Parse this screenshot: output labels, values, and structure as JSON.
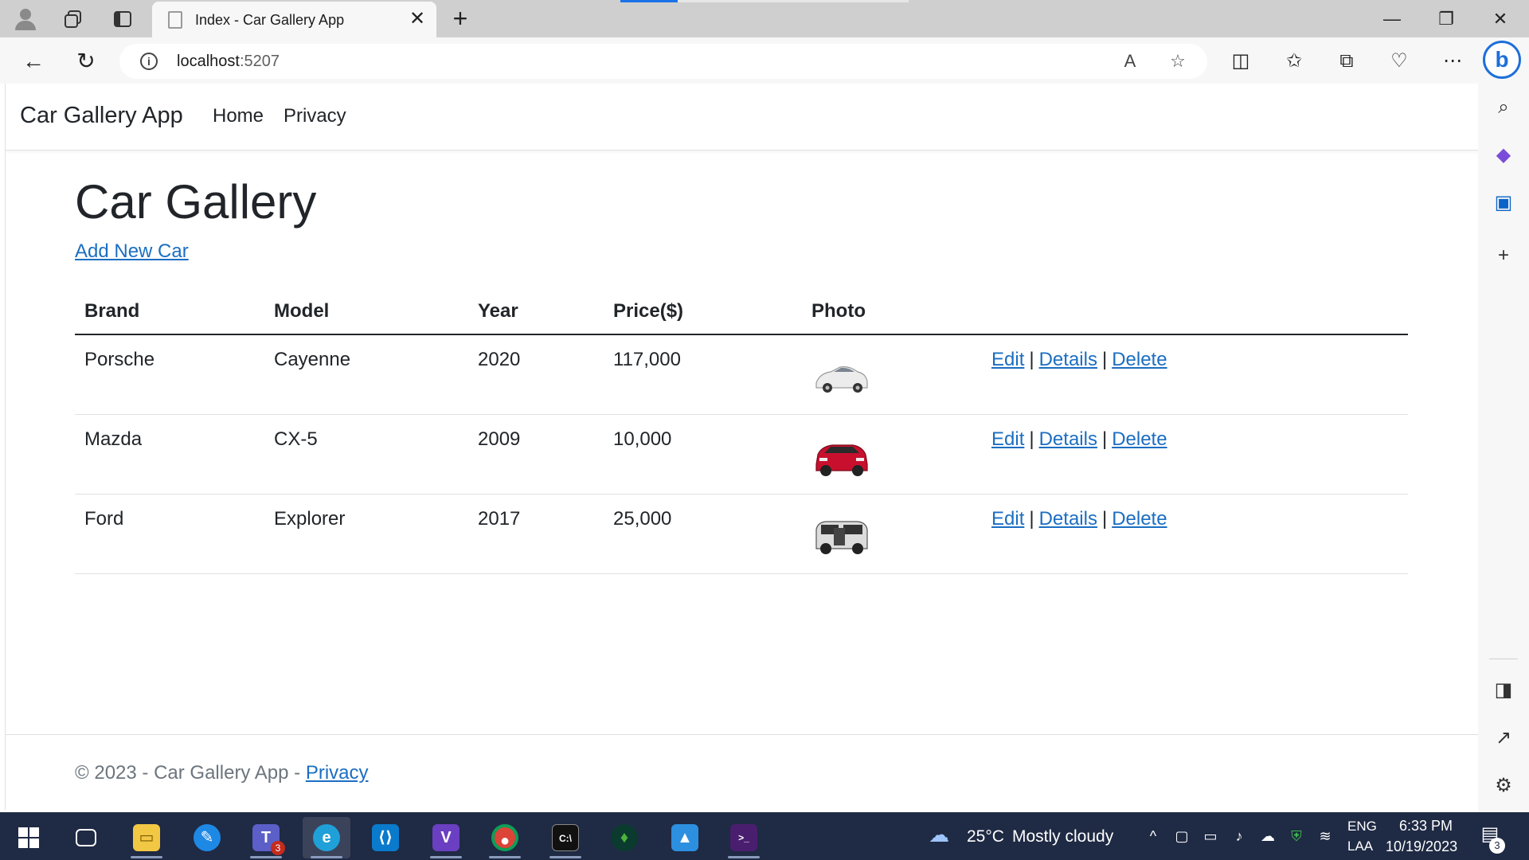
{
  "browser": {
    "tab_title": "Index - Car Gallery App",
    "url_host": "localhost",
    "url_port": ":5207"
  },
  "app": {
    "brand": "Car Gallery App",
    "nav": [
      "Home",
      "Privacy"
    ]
  },
  "page": {
    "title": "Car Gallery",
    "add_link": "Add New Car"
  },
  "table": {
    "headers": [
      "Brand",
      "Model",
      "Year",
      "Price($)",
      "Photo"
    ],
    "rows": [
      {
        "brand": "Porsche",
        "model": "Cayenne",
        "year": "2020",
        "price": "117,000",
        "photo_color": "#e8e8e8"
      },
      {
        "brand": "Mazda",
        "model": "CX-5",
        "year": "2009",
        "price": "10,000",
        "photo_color": "#c8102e"
      },
      {
        "brand": "Ford",
        "model": "Explorer",
        "year": "2017",
        "price": "25,000",
        "photo_color": "#dcdcdc"
      }
    ],
    "actions": {
      "edit": "Edit",
      "details": "Details",
      "delete": "Delete",
      "separator": "|"
    }
  },
  "footer": {
    "text": "© 2023 - Car Gallery App - ",
    "link": "Privacy"
  },
  "taskbar": {
    "weather_temp": "25°C",
    "weather_desc": "Mostly cloudy",
    "lang_top": "ENG",
    "lang_bottom": "LAA",
    "time": "6:33 PM",
    "date": "10/19/2023",
    "notification_count": "3",
    "teams_badge": "3"
  },
  "colors": {
    "link": "#1b6ec2",
    "taskbar": "#1f2a44",
    "chrome": "#f7f7f7"
  }
}
